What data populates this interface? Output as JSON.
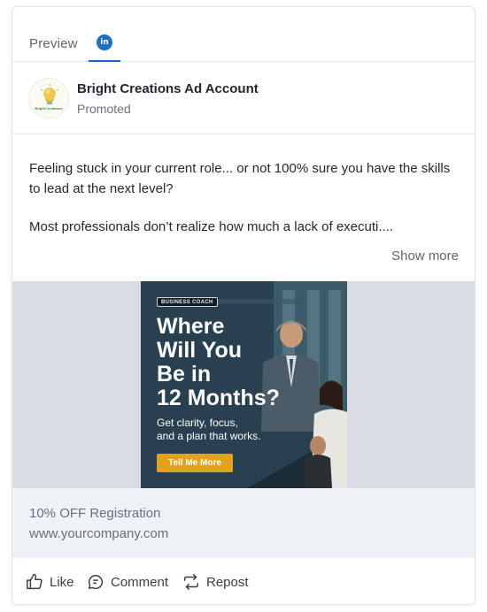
{
  "tabs": {
    "preview_label": "Preview",
    "linkedin_badge": "in"
  },
  "post": {
    "account_name": "Bright Creations Ad Account",
    "sponsor_label": "Promoted",
    "avatar_caption": "Bright Creations",
    "paragraph_1": "Feeling stuck in your current role... or not 100% sure you have the skills to lead at the next level?",
    "paragraph_2": "Most professionals don’t realize how much a lack of executi....",
    "show_more": "Show more"
  },
  "ad": {
    "badge": "BUSINESS COACH",
    "headline_1": "Where",
    "headline_2": "Will You",
    "headline_3": "Be in",
    "headline_4": "12 Months?",
    "sub_1": "Get clarity, focus,",
    "sub_2": "and a plan that works.",
    "cta": "Tell Me More"
  },
  "link": {
    "offer": "10% OFF Registration",
    "url": "www.yourcompany.com"
  },
  "actions": {
    "like": "Like",
    "comment": "Comment",
    "repost": "Repost"
  },
  "colors": {
    "accent": "#1a5fd0",
    "linkedin_blue": "#1d6ec5",
    "cta_yellow": "#e2a21c",
    "link_area_bg": "#eef2f6"
  },
  "icons": {
    "linkedin": "linkedin-icon",
    "like": "thumbs-up-icon",
    "comment": "comment-bubble-icon",
    "repost": "repost-arrows-icon",
    "avatar": "lightbulb-logo"
  }
}
